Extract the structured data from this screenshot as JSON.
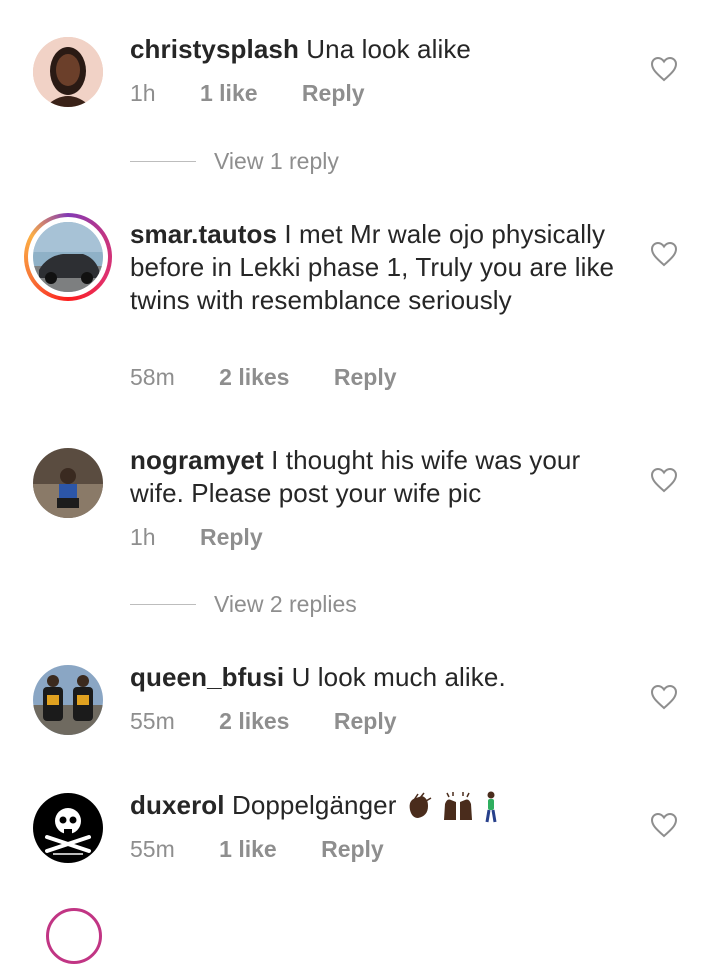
{
  "comments": [
    {
      "username": "christysplash",
      "text": "Una look alike",
      "time": "1h",
      "likes": "1 like",
      "reply": "Reply",
      "view_replies": "View 1 reply"
    },
    {
      "username": "smar.tautos",
      "text": "I met Mr wale ojo physically before in Lekki phase 1, Truly you are like twins with resemblance seriously",
      "time": "58m",
      "likes": "2 likes",
      "reply": "Reply"
    },
    {
      "username": "nogramyet",
      "text": "I thought his wife was your wife. Please post your wife pic",
      "time": "1h",
      "reply": "Reply",
      "view_replies": "View 2 replies"
    },
    {
      "username": "queen_bfusi",
      "text": "U look much alike.",
      "time": "55m",
      "likes": "2 likes",
      "reply": "Reply"
    },
    {
      "username": "duxerol",
      "text": "Doppelgänger",
      "time": "55m",
      "likes": "1 like",
      "reply": "Reply"
    }
  ],
  "colors": {
    "text": "#262626",
    "meta": "#8e8e8e",
    "story_ring": [
      "#833ab4",
      "#e1306c",
      "#fcaf45"
    ]
  },
  "icons": {
    "like": "heart-outline-icon"
  }
}
